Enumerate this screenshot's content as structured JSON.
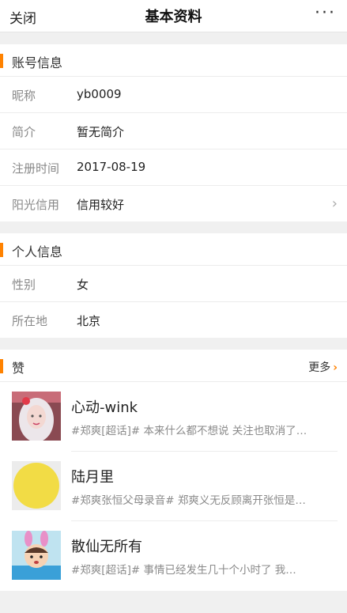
{
  "header": {
    "close_label": "关闭",
    "title": "基本资料",
    "more_label": "···"
  },
  "account": {
    "title": "账号信息",
    "rows": [
      {
        "key": "昵称",
        "value": "yb0009"
      },
      {
        "key": "简介",
        "value": "暂无简介"
      },
      {
        "key": "注册时间",
        "value": "2017-08-19"
      },
      {
        "key": "阳光信用",
        "value": "信用较好"
      }
    ]
  },
  "personal": {
    "title": "个人信息",
    "rows": [
      {
        "key": "性别",
        "value": "女"
      },
      {
        "key": "所在地",
        "value": "北京"
      }
    ]
  },
  "likes": {
    "title": "赞",
    "more_label": "更多",
    "items": [
      {
        "name": "心动-wink",
        "text": "#郑爽[超话]# 本来什么都不想说 关注也取消了…"
      },
      {
        "name": "陆月里",
        "text": "#郑爽张恒父母录音# 郑爽义无反顾离开张恒是…"
      },
      {
        "name": "散仙无所有",
        "text": "#郑爽[超话]# 事情已经发生几十个小时了 我…"
      }
    ]
  },
  "colors": {
    "accent": "#ff8200"
  }
}
